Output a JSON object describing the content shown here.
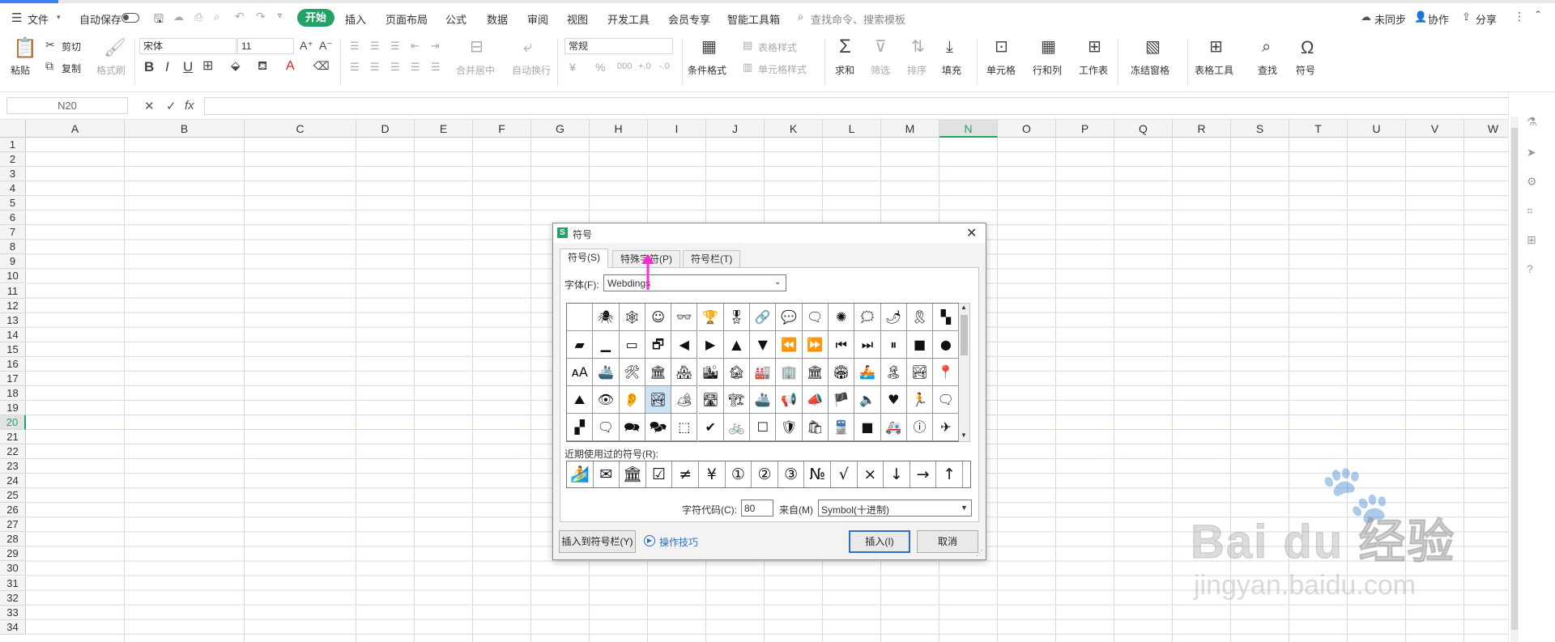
{
  "menubar": {
    "file": "文件",
    "autosave": "自动保存",
    "tabs": [
      "开始",
      "插入",
      "页面布局",
      "公式",
      "数据",
      "审阅",
      "视图",
      "开发工具",
      "会员专享",
      "智能工具箱"
    ],
    "search_placeholder": "查找命令、搜索模板",
    "sync": "未同步",
    "collab": "协作",
    "share": "分享"
  },
  "ribbon": {
    "paste": "粘贴",
    "cut": "剪切",
    "copy": "复制",
    "format_painter": "格式刷",
    "font_name": "宋体",
    "font_size": "11",
    "merge_center": "合并居中",
    "wrap_text": "自动换行",
    "number_format": "常规",
    "conditional_format": "条件格式",
    "table_style": "表格样式",
    "cell_style": "单元格样式",
    "sum": "求和",
    "filter": "筛选",
    "sort": "排序",
    "fill": "填充",
    "cell": "单元格",
    "row_col": "行和列",
    "worksheet": "工作表",
    "freeze": "冻结窗格",
    "table_tools": "表格工具",
    "find": "查找",
    "symbol": "符号"
  },
  "formula_bar": {
    "name_box": "N20",
    "fx": "fx"
  },
  "sheet": {
    "columns": [
      "A",
      "B",
      "C",
      "D",
      "E",
      "F",
      "G",
      "H",
      "I",
      "J",
      "K",
      "L",
      "M",
      "N",
      "O",
      "P",
      "Q",
      "R",
      "S",
      "T",
      "U",
      "V",
      "W"
    ],
    "rows": [
      "1",
      "2",
      "3",
      "4",
      "5",
      "6",
      "7",
      "8",
      "9",
      "10",
      "11",
      "12",
      "13",
      "14",
      "15",
      "16",
      "17",
      "18",
      "19",
      "20",
      "21",
      "22",
      "23",
      "24",
      "25",
      "26",
      "27",
      "28",
      "29",
      "30",
      "31",
      "32",
      "33",
      "34"
    ],
    "active_column": "N",
    "active_row": "20"
  },
  "dialog": {
    "title": "符号",
    "tabs": [
      "符号(S)",
      "特殊字符(P)",
      "符号栏(T)"
    ],
    "font_label": "字体(F):",
    "font_value": "Webdings",
    "symbols": [
      [
        "",
        "🕷",
        "🕸",
        "☺",
        "👓",
        "🏆",
        "🎖",
        "🔗",
        "💬",
        "🗨",
        "✺",
        "🗯",
        "🌶",
        "🎗",
        "▚"
      ],
      [
        "▰",
        "▁",
        "▭",
        "🗗",
        "◀",
        "▶",
        "▲",
        "▼",
        "⏪",
        "⏩",
        "⏮",
        "⏭",
        "⏸",
        "■",
        "●"
      ],
      [
        "ᴀA",
        "🚢",
        "🛠",
        "🏛",
        "🏘",
        "🏙",
        "🏚",
        "🏭",
        "🏢",
        "🏛",
        "🏟",
        "🚣",
        "🏝",
        "🏞",
        "📍"
      ],
      [
        "⛰",
        "👁",
        "👂",
        "🏞",
        "🏕",
        "🛣",
        "🏗",
        "🚢",
        "📢",
        "📣",
        "🏴",
        "🔈",
        "♥",
        "🏃",
        "🗨"
      ],
      [
        "▞",
        "🗨",
        "🗪",
        "🗫",
        "⬚",
        "✔",
        "🚲",
        "☐",
        "🛡",
        "🛍",
        "🚆",
        "■",
        "🚑",
        "ⓘ",
        "✈"
      ]
    ],
    "recent_label": "近期使用过的符号(R):",
    "recent": [
      "🏄",
      "✉",
      "🏛",
      "☑",
      "≠",
      "¥",
      "①",
      "②",
      "③",
      "№",
      "√",
      "×",
      "↓",
      "→",
      "↑"
    ],
    "char_code_label": "字符代码(C):",
    "char_code": "80",
    "from_label": "来自(M)",
    "from_value": "Symbol(十进制)",
    "insert_to_bar": "插入到符号栏(Y)",
    "tips": "操作技巧",
    "insert": "插入(I)",
    "cancel": "取消"
  },
  "watermark": {
    "brand": "Bai du 经验",
    "url": "jingyan.baidu.com"
  },
  "colors": {
    "accent": "#21a366",
    "highlight_arrow": "#ff2ad4",
    "tips_link": "#2a6fc9"
  }
}
